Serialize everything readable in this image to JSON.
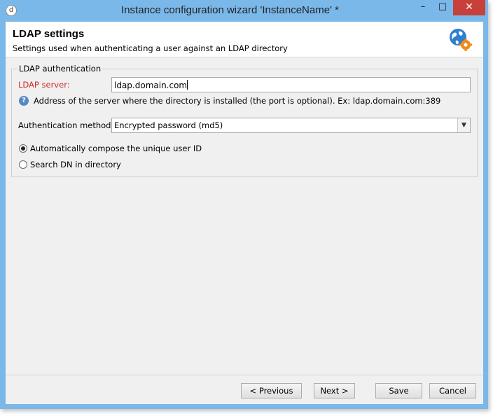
{
  "window": {
    "title": "Instance configuration wizard 'InstanceName' *",
    "app_icon": "d",
    "minimize_glyph": "–",
    "maximize_glyph": "□",
    "close_glyph": "✕"
  },
  "header": {
    "title": "LDAP settings",
    "subtitle": "Settings used when authenticating a user against an LDAP directory",
    "icon": "globe-gear-icon"
  },
  "ldap_group": {
    "legend": "LDAP authentication",
    "server_label": "LDAP server:",
    "server_value": "ldap.domain.com",
    "help_glyph": "?",
    "help_text": "Address of the server where the directory is installed (the port is optional). Ex: ldap.domain.com:389",
    "auth_method_label": "Authentication method:",
    "auth_method_value": "Encrypted password (md5)",
    "dropdown_glyph": "▼",
    "radio_options": [
      {
        "label": "Automatically compose the unique user ID",
        "checked": true
      },
      {
        "label": "Search DN in directory",
        "checked": false
      }
    ]
  },
  "footer": {
    "previous_label": "< Previous",
    "next_label": "Next >",
    "save_label": "Save",
    "cancel_label": "Cancel"
  },
  "colors": {
    "titlebar": "#7ab8ea",
    "close_button": "#c7403a",
    "required_label": "#d22b2b"
  }
}
